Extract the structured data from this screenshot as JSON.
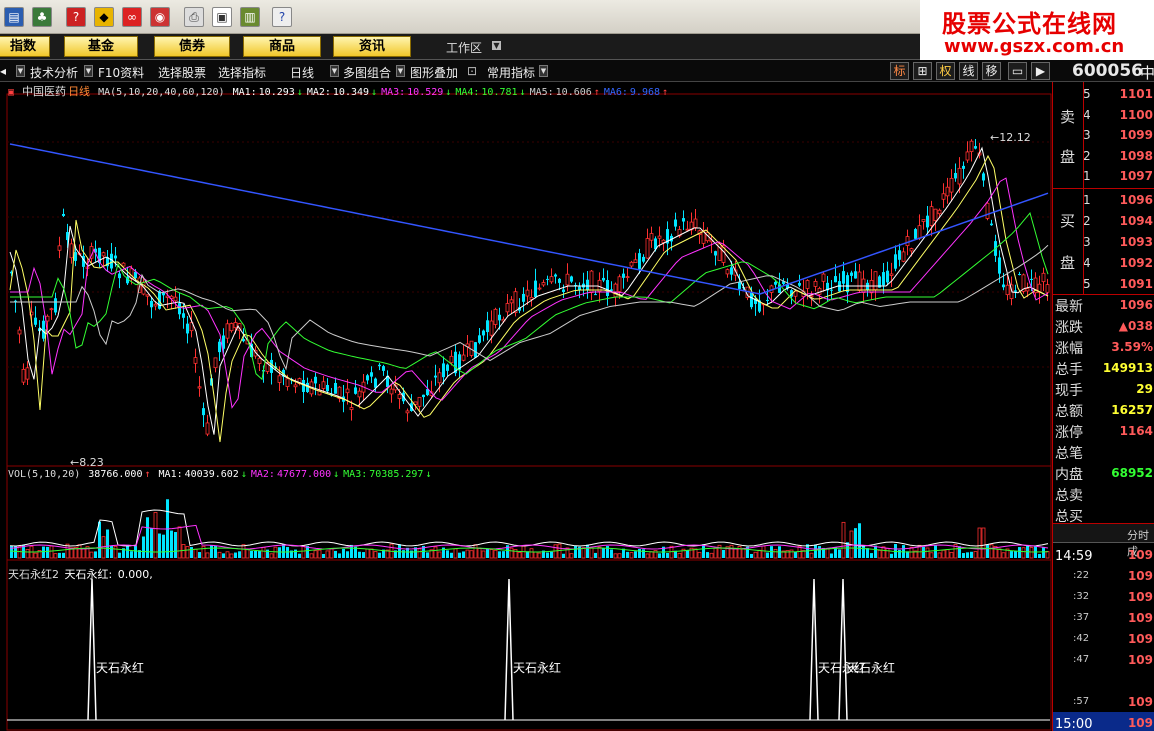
{
  "toolbar": {
    "icons": [
      "market-icon",
      "chart-tool-icon",
      "alert-icon",
      "diamond-icon",
      "link-icon",
      "news-icon",
      "print-icon",
      "window-icon",
      "bars-icon",
      "help-icon"
    ]
  },
  "banner": {
    "title": "股票公式在线网",
    "url": "www.gszx.com.cn"
  },
  "menu": {
    "items": [
      "指数",
      "基金",
      "债券",
      "商品",
      "资讯"
    ],
    "workspace": "工作区",
    "workspace_arrow": "▼"
  },
  "func_bar": {
    "items": [
      "技术分析",
      "F10资料",
      "选择股票",
      "选择指标",
      "日线",
      "多图组合",
      "图形叠加",
      "常用指标"
    ],
    "view_buttons": [
      "标",
      "⊞",
      "权",
      "线",
      "移",
      "▭",
      "▶"
    ],
    "stock_code": "600056",
    "stock_code_suffix": "中"
  },
  "main_legend": {
    "name": "中国医药",
    "period": "日线",
    "ma_params": "MA(5,10,20,40,60,120)",
    "ma": [
      {
        "label": "MA1:",
        "value": "10.293",
        "dir": "↓",
        "color": "#ffffff"
      },
      {
        "label": "MA2:",
        "value": "10.349",
        "dir": "↓",
        "color": "#ffffff"
      },
      {
        "label": "MA3:",
        "value": "10.529",
        "dir": "↓",
        "color": "#ff33ff"
      },
      {
        "label": "MA4:",
        "value": "10.781",
        "dir": "↓",
        "color": "#33ff33"
      },
      {
        "label": "MA5:",
        "value": "10.606",
        "dir": "↑",
        "color": "#cccccc"
      },
      {
        "label": "MA6:",
        "value": "9.968",
        "dir": "↑",
        "color": "#3366ff"
      }
    ]
  },
  "price_annotations": {
    "high": "12.12",
    "low": "8.23"
  },
  "volume_legend": {
    "params": "VOL(5,10,20)",
    "vol": "38766.000",
    "vol_dir": "↑",
    "ma": [
      {
        "label": "MA1:",
        "value": "40039.602",
        "dir": "↓",
        "color": "#ffffff"
      },
      {
        "label": "MA2:",
        "value": "47677.000",
        "dir": "↓",
        "color": "#ff33ff"
      },
      {
        "label": "MA3:",
        "value": "70385.297",
        "dir": "↓",
        "color": "#33ff33"
      }
    ]
  },
  "indicator": {
    "name": "天石永红2",
    "value_label": "天石永红:",
    "value": "0.000,",
    "signal_label": "天石永红"
  },
  "quote": {
    "sell_label": [
      "卖",
      "盘"
    ],
    "buy_label": [
      "买",
      "盘"
    ],
    "sell_book": [
      {
        "idx": "5",
        "price": "1101"
      },
      {
        "idx": "4",
        "price": "1100"
      },
      {
        "idx": "3",
        "price": "1099"
      },
      {
        "idx": "2",
        "price": "1098"
      },
      {
        "idx": "1",
        "price": "1097"
      }
    ],
    "buy_book": [
      {
        "idx": "1",
        "price": "1096"
      },
      {
        "idx": "2",
        "price": "1094"
      },
      {
        "idx": "3",
        "price": "1093"
      },
      {
        "idx": "4",
        "price": "1092"
      },
      {
        "idx": "5",
        "price": "1091"
      }
    ],
    "stats": [
      {
        "label": "最新",
        "value": "1096",
        "color": "#ff5a5a"
      },
      {
        "label": "涨跌",
        "value": "▲038",
        "color": "#ff5a5a"
      },
      {
        "label": "涨幅",
        "value": "3.59%",
        "color": "#ff5a5a"
      },
      {
        "label": "总手",
        "value": "149913",
        "color": "#ffff33"
      },
      {
        "label": "现手",
        "value": "29",
        "color": "#ffff33"
      },
      {
        "label": "总额",
        "value": "16257",
        "color": "#ffff33"
      },
      {
        "label": "涨停",
        "value": "1164",
        "color": "#ff5a5a"
      },
      {
        "label": "总笔",
        "value": "",
        "color": "#ffff33"
      },
      {
        "label": "内盘",
        "value": "68952",
        "color": "#33ff33"
      },
      {
        "label": "总卖",
        "value": "",
        "color": "#ffff33"
      },
      {
        "label": "总买",
        "value": "",
        "color": "#ffff33"
      }
    ],
    "tab_label": "分时成",
    "ticks": [
      {
        "time": "14:59",
        "price": "109"
      },
      {
        "time": ":22",
        "price": "109"
      },
      {
        "time": ":32",
        "price": "109"
      },
      {
        "time": ":37",
        "price": "109"
      },
      {
        "time": ":42",
        "price": "109"
      },
      {
        "time": ":47",
        "price": "109"
      },
      {
        "time": ":57",
        "price": "109"
      },
      {
        "time": "15:00",
        "price": "109"
      }
    ]
  }
}
